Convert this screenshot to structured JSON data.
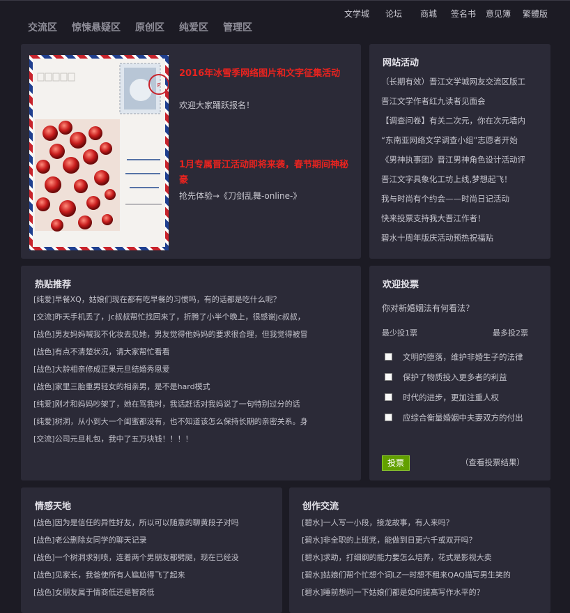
{
  "top_links": [
    "文学城",
    "论坛",
    "商城",
    "签名书",
    "意见簿",
    "繁體版"
  ],
  "main_nav": [
    "交流区",
    "惊悚悬疑区",
    "原创区",
    "纯爱区",
    "管理区"
  ],
  "banner": {
    "image_alt": "冰雪季明信片图片",
    "news": [
      {
        "title": "2016年冰雪季网络图片和文字征集活动",
        "desc": "欢迎大家踊跃报名！"
      },
      {
        "title": "1月专属晋江活动即将来袭，春节期间神秘豪",
        "desc": "抢先体验→《刀剑乱舞-online-》"
      }
    ]
  },
  "activities": {
    "title": "网站活动",
    "items": [
      "（长期有效）晋江文学城网友交流区版工",
      "晋江文学作者红九读者见面会",
      "【调查问卷】有关二次元，你在次元墙内",
      "“东南亚网络文学调查小组”志愿者开始",
      "《男神执事团》晋江男神角色设计活动评",
      "晋江文字具象化工坊上线,梦想起飞！",
      "我与时尚有个约会——时尚日记活动",
      "快来投票支持我大晋江作者！",
      "碧水十周年版庆活动预热祝福贴"
    ]
  },
  "hot_posts": {
    "title": "热贴推荐",
    "items": [
      "[纯爱]早餐XQ，姑娘们现在都有吃早餐的习惯吗，有的话都是吃什么呢？",
      "[交流]昨天手机丢了，jc叔叔帮忙找回来了，折腾了小半个晚上，很感谢jc叔叔，",
      "[战色]男友妈妈喊我不化妆去见她，男友觉得他妈妈的要求很合理，但我觉得被冒",
      "[战色]有点不清楚状况，请大家帮忙看看",
      "[战色]大龄相亲修成正果元旦结婚秀恩爱",
      "[战色]家里三胎重男轻女的相亲男，是不是hard模式",
      "[纯爱]刚才和妈妈吵架了，她在骂我时，我话赶话对我妈说了一句特别过分的话",
      "[纯爱]树洞，从小到大一个闺蜜都没有，也不知道该怎么保持长期的亲密关系。身",
      "[交流]公司元旦札包，我中了五万块钱！！！！"
    ]
  },
  "poll": {
    "title": "欢迎投票",
    "question": "你对新婚姻法有何看法？",
    "min_label": "最少投1票",
    "max_label": "最多投2票",
    "options": [
      "文明的堕落，维护非婚生子的法律",
      "保护了物质投入更多者的利益",
      "时代的进步，更加注重人权",
      "应综合衡量婚姻中夫妻双方的付出"
    ],
    "vote_label": "投票",
    "view_results_label": "（查看投票结果）"
  },
  "emotion": {
    "title": "情感天地",
    "items": [
      "[战色]因为是信任的异性好友，所以可以随意的聊黄段子对吗",
      "[战色]老公删除女同学的聊天记录",
      "[战色]一个树洞求别喷，连着两个男朋友都劈腿，现在已经没",
      "[战色]见家长，我爸使所有人尴尬得飞了起来",
      "[战色]女朋友属于情商低还是智商低"
    ]
  },
  "creation": {
    "title": "创作交流",
    "items": [
      "[碧水]一人写一小段，接龙故事，有人来吗？",
      "[碧水]非全职的上班党，能做到日更六千或双开吗？",
      "[碧水]求助，打细纲的能力要怎么培养，花式是影视大卖",
      "[碧水]姑娘们帮个忙想个词LZ一时想不租来QAQ描写男生笑的",
      "[碧水]睡前想问一下姑娘们都是如何提高写作水平的？"
    ]
  }
}
